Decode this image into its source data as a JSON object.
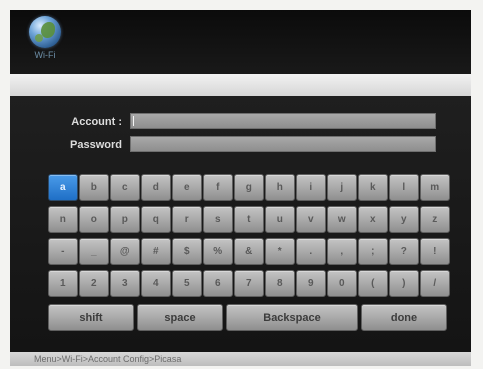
{
  "header": {
    "logo_label": "Wi-Fi",
    "logo_icon": "globe-icon"
  },
  "form": {
    "account_label": "Account :",
    "password_label": "Password",
    "account_value": "",
    "password_value": ""
  },
  "keyboard": {
    "active_key": "a",
    "rows": [
      [
        "a",
        "b",
        "c",
        "d",
        "e",
        "f",
        "g",
        "h",
        "i",
        "j",
        "k",
        "l",
        "m"
      ],
      [
        "n",
        "o",
        "p",
        "q",
        "r",
        "s",
        "t",
        "u",
        "v",
        "w",
        "x",
        "y",
        "z"
      ],
      [
        "-",
        "_",
        "@",
        "#",
        "$",
        "%",
        "&",
        "*",
        ".",
        ",",
        ";",
        "?",
        "!"
      ],
      [
        "1",
        "2",
        "3",
        "4",
        "5",
        "6",
        "7",
        "8",
        "9",
        "0",
        "(",
        ")",
        "/"
      ]
    ],
    "actions": {
      "shift": "shift",
      "space": "space",
      "backspace": "Backspace",
      "done": "done"
    }
  },
  "status": {
    "breadcrumb": "Menu>Wi-Fi>Account Config>Picasa"
  },
  "colors": {
    "accent": "#2f84db",
    "background": "#151515",
    "keys": "#a9a9a9"
  }
}
